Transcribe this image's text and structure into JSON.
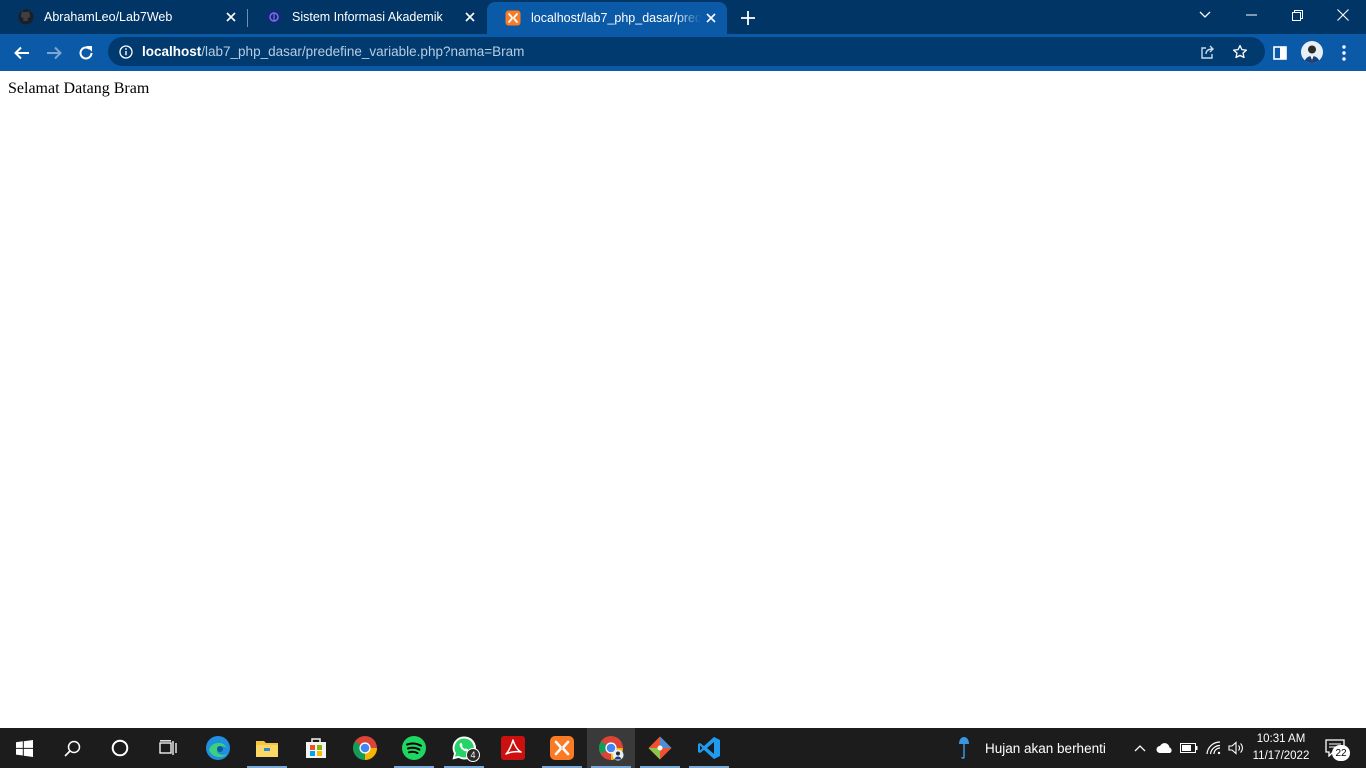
{
  "browser": {
    "tabs": [
      {
        "title": "AbrahamLeo/Lab7Web",
        "favicon": "github-icon"
      },
      {
        "title": "Sistem Informasi Akademik",
        "favicon": "university-logo-icon"
      },
      {
        "title": "localhost/lab7_php_dasar/predefine_variable.php?nama=Bram",
        "favicon": "xampp-icon"
      }
    ],
    "address_bar": {
      "host": "localhost",
      "path": "/lab7_php_dasar/predefine_variable.php?nama=Bram"
    },
    "colors": {
      "tabstrip": "#013565",
      "toolbar": "#0a5aa7",
      "omnibox": "#013a6e"
    }
  },
  "page": {
    "greeting": "Selamat Datang Bram"
  },
  "taskbar": {
    "apps": [
      "start-icon",
      "search-icon",
      "cortana-icon",
      "task-view-icon",
      "edge-icon",
      "file-explorer-icon",
      "store-icon",
      "chrome-icon",
      "spotify-icon",
      "whatsapp-icon",
      "acrobat-icon",
      "xampp-icon",
      "chrome-profile-icon",
      "git-icon",
      "vscode-icon"
    ],
    "whatsapp_badge": "4",
    "weather_text": "Hujan akan berhenti",
    "time": "10:31 AM",
    "date": "11/17/2022",
    "notification_count": "22"
  }
}
